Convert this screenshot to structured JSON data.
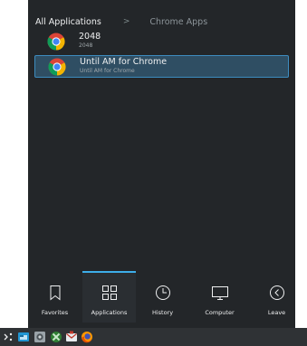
{
  "breadcrumb": {
    "root": "All Applications",
    "separator": ">",
    "current": "Chrome Apps"
  },
  "apps": [
    {
      "name": "2048",
      "subtitle": "2048",
      "icon": "chrome-icon",
      "selected": false
    },
    {
      "name": "Until AM for Chrome",
      "subtitle": "Until AM for Chrome",
      "icon": "chrome-icon",
      "selected": true
    }
  ],
  "tabs": [
    {
      "label": "Favorites",
      "icon": "bookmark-icon"
    },
    {
      "label": "Applications",
      "icon": "grid-icon",
      "active": true
    },
    {
      "label": "History",
      "icon": "clock-icon"
    },
    {
      "label": "Computer",
      "icon": "monitor-icon"
    },
    {
      "label": "Leave",
      "icon": "chevron-left-circle-icon"
    }
  ],
  "taskbar": {
    "icons": [
      "kickoff-launcher-icon",
      "file-manager-icon",
      "system-settings-icon",
      "game-icon",
      "mail-icon",
      "firefox-icon"
    ]
  },
  "colors": {
    "background": "#232629",
    "accent": "#3daee9",
    "selection": "#2f4e63",
    "panel": "#2f3235"
  }
}
